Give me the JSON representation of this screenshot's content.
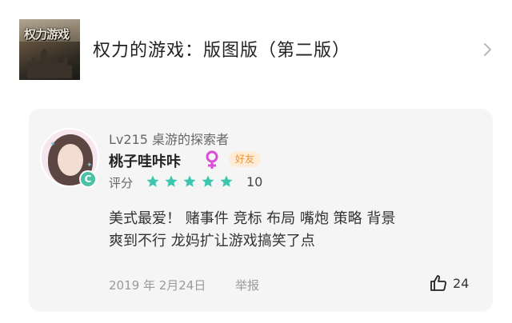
{
  "game": {
    "cover_logo": "权力游戏",
    "title": "权力的游戏：版图版（第二版）"
  },
  "review": {
    "level": "Lv215 桌游的探索者",
    "username": "桃子哇咔咔",
    "badge_symbol": "C",
    "friend_badge": "好友",
    "rating_label": "评分",
    "rating_score": "10",
    "star_count": 5,
    "text_lines": [
      "美式最爱！ 赌事件 竞标 布局 嘴炮 策略 背景",
      "爽到不行 龙妈扩让游戏搞笑了点"
    ],
    "date": "2019 年 2月24日",
    "report_label": "举报",
    "like_count": "24"
  },
  "colors": {
    "star": "#3ec5b0",
    "gender": "#d94fd6",
    "friend_badge_bg": "#ffecd6",
    "friend_badge_text": "#f0923a",
    "card_bg": "#f5f5f5"
  },
  "icons": {
    "chevron": "chevron-right-icon",
    "gender": "female-icon",
    "star": "star-icon",
    "like": "thumbs-up-icon"
  }
}
